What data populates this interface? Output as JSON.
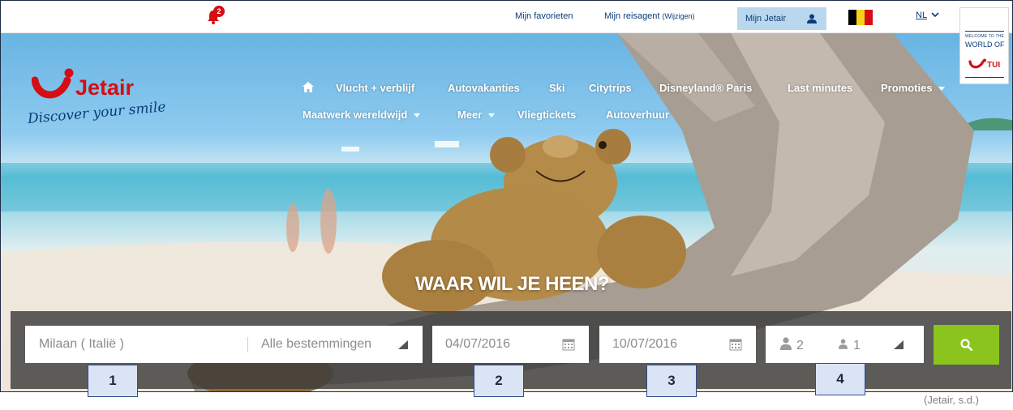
{
  "topbar": {
    "notification_count": "2",
    "favorites_link": "Mijn favorieten",
    "travel_agent_link": "Mijn reisagent",
    "travel_agent_change": "(Wijzigen)",
    "account_button": "Mijn Jetair",
    "language": "NL",
    "flag_colors": [
      "#000000",
      "#f7d117",
      "#d40e14"
    ]
  },
  "tui_badge": {
    "welcome": "WELCOME TO THE",
    "world": "WORLD OF",
    "brand": "TUI"
  },
  "brand": {
    "name": "Jetair",
    "slogan": "Discover your smile",
    "color": "#d40e14"
  },
  "nav": {
    "home_icon": "home-icon",
    "row1": [
      "Vlucht + verblijf",
      "Autovakanties",
      "Ski",
      "Citytrips",
      "Disneyland® Paris",
      "Last minutes",
      "Promoties"
    ],
    "row2": [
      "Maatwerk wereldwijd",
      "Meer",
      "Vliegtickets",
      "Autoverhuur"
    ]
  },
  "hero": {
    "headline": "WAAR WIL JE HEEN?"
  },
  "search": {
    "departure_value": "Milaan ( Italië )",
    "destination_value": "Alle bestemmingen",
    "depart_date": "04/07/2016",
    "return_date": "10/07/2016",
    "adults": "2",
    "children": "1",
    "button_icon": "search-icon",
    "button_color": "#8cc41e"
  },
  "markers": [
    "1",
    "2",
    "3",
    "4"
  ],
  "caption": "(Jetair, s.d.)"
}
